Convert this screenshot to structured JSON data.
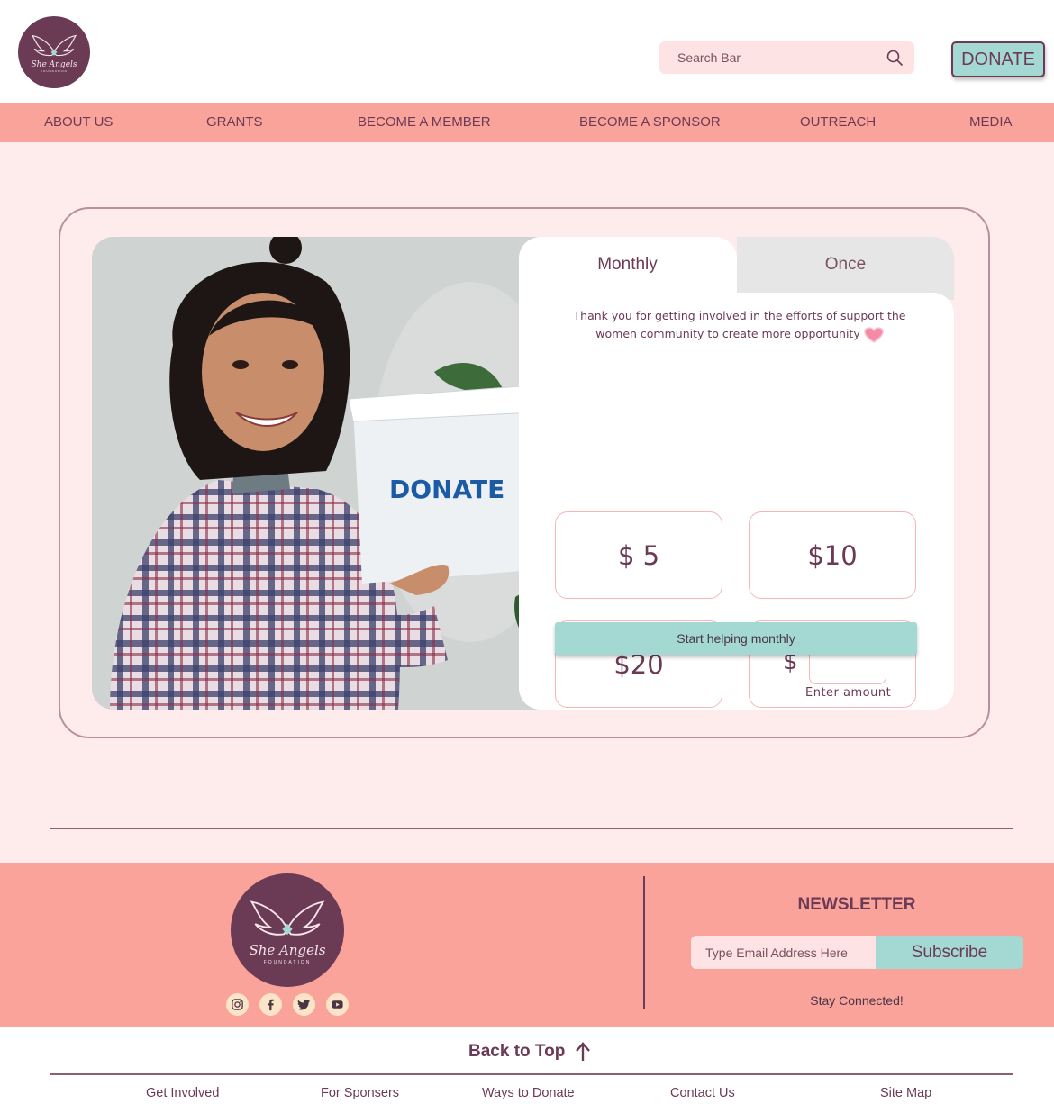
{
  "colors": {
    "brand_plum": "#6b3a55",
    "nav_salmon": "#f9a39b",
    "page_blush": "#fdeceb",
    "accent_teal": "#a4d8d2",
    "search_pink": "#fde3e3"
  },
  "header": {
    "logo": {
      "icon": "angel-wings-logo",
      "script": "She Angels",
      "sub": "FOUNDATION"
    },
    "search": {
      "placeholder": "Search Bar",
      "icon": "search-icon"
    },
    "donate_label": "DONATE"
  },
  "nav": {
    "items": [
      {
        "label": "ABOUT US"
      },
      {
        "label": "GRANTS"
      },
      {
        "label": "BECOME A MEMBER"
      },
      {
        "label": "BECOME A SPONSOR"
      },
      {
        "label": "OUTREACH"
      },
      {
        "label": "MEDIA"
      }
    ]
  },
  "donation": {
    "photo_box_label": "DONATE",
    "tabs": {
      "monthly": "Monthly",
      "once": "Once"
    },
    "selected_tab": "Monthly",
    "thanks_line1": "Thank you for getting involved in the efforts of support the",
    "thanks_line2": "women community to create more opportunity",
    "amounts": [
      "$ 5",
      "$10",
      "$20"
    ],
    "custom": {
      "currency": "$",
      "hint": "Enter amount"
    },
    "start_label": "Start helping monthly"
  },
  "footer": {
    "logo": {
      "icon": "angel-wings-logo",
      "script": "She Angels",
      "sub": "FOUNDATION"
    },
    "socials": [
      "instagram-icon",
      "facebook-icon",
      "twitter-icon",
      "youtube-icon"
    ],
    "newsletter": {
      "title": "NEWSLETTER",
      "placeholder": "Type Email Address Here",
      "subscribe_label": "Subscribe",
      "tagline": "Stay Connected!"
    }
  },
  "bottom": {
    "back_to_top": "Back to Top",
    "links": [
      {
        "label": "Get Involved"
      },
      {
        "label": "For Sponsers"
      },
      {
        "label": "Ways to Donate"
      },
      {
        "label": "Contact Us"
      },
      {
        "label": "Site Map"
      }
    ]
  }
}
